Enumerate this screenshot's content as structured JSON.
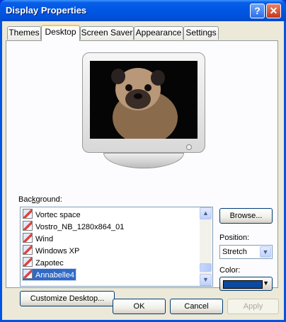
{
  "window": {
    "title": "Display Properties",
    "help_label": "?",
    "close_label": "✕"
  },
  "tabs": [
    {
      "label": "Themes",
      "active": false
    },
    {
      "label": "Desktop",
      "active": true
    },
    {
      "label": "Screen Saver",
      "active": false
    },
    {
      "label": "Appearance",
      "active": false
    },
    {
      "label": "Settings",
      "active": false
    }
  ],
  "desktop": {
    "background_label_pre": "Bac",
    "background_label_key": "k",
    "background_label_post": "ground:",
    "background_items": [
      {
        "label": "Vortec space",
        "icon": "picture-icon"
      },
      {
        "label": "Vostro_NB_1280x864_01",
        "icon": "picture-icon"
      },
      {
        "label": "Wind",
        "icon": "picture-icon"
      },
      {
        "label": "Windows XP",
        "icon": "picture-icon"
      },
      {
        "label": "Zapotec",
        "icon": "picture-icon"
      },
      {
        "label": "Annabelle4",
        "icon": "picture-icon",
        "selected": true
      }
    ],
    "browse_label": "Browse...",
    "position_label": "Position:",
    "position_value": "Stretch",
    "color_label": "Color:",
    "color_value": "#0b4aa0",
    "customize_label": "Customize Desktop..."
  },
  "buttons": {
    "ok": "OK",
    "cancel": "Cancel",
    "apply": "Apply"
  },
  "colors": {
    "titlebar": "#0058e6",
    "selection": "#316ac5",
    "active_tab_accent": "#ffc83c"
  }
}
